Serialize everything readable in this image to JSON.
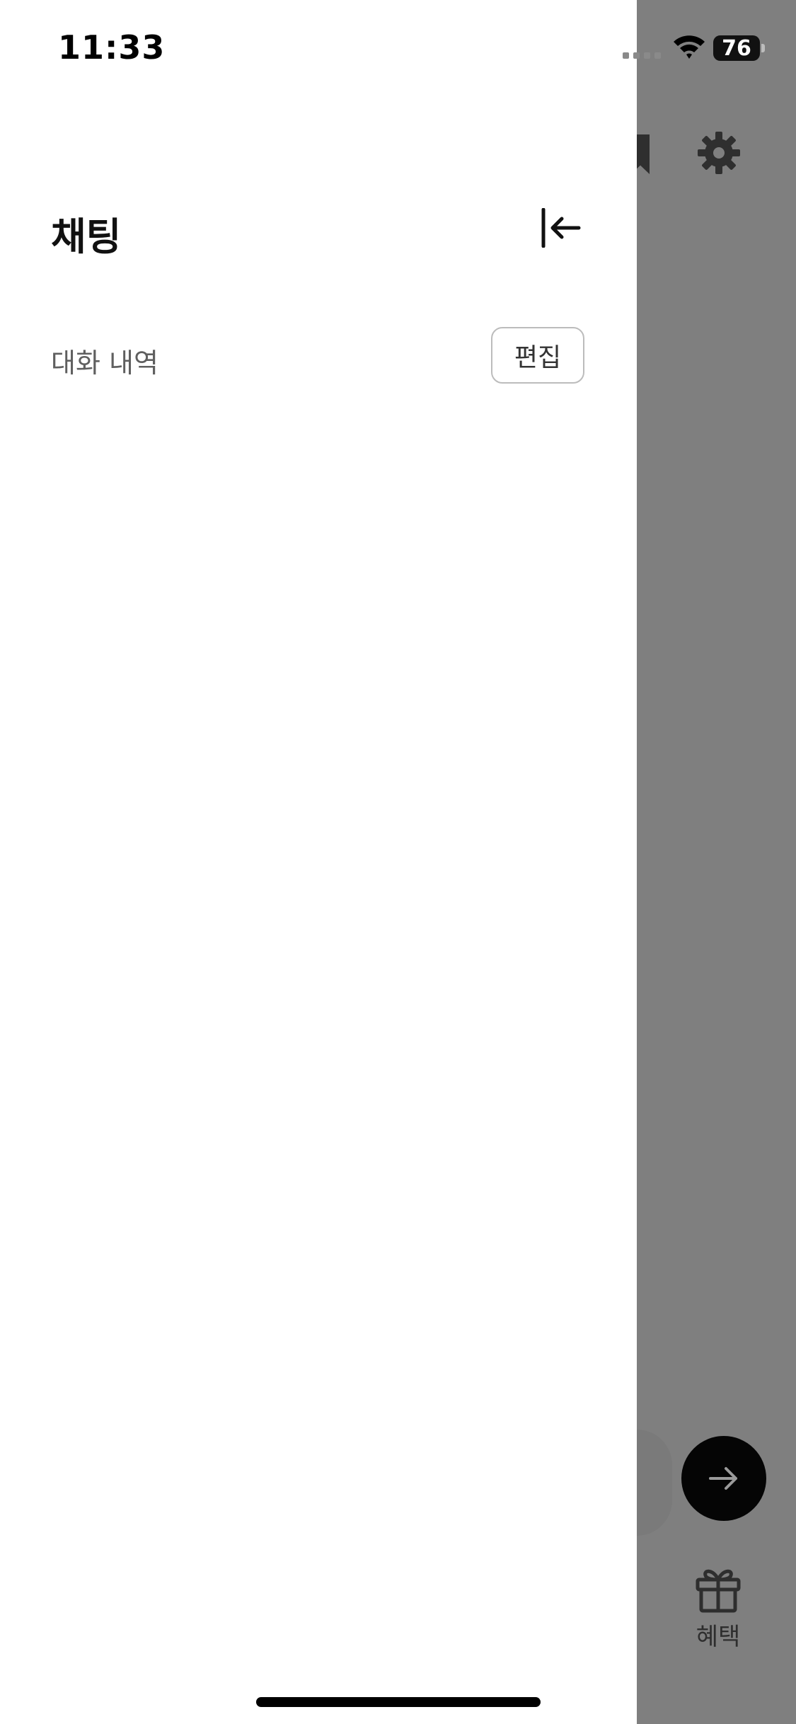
{
  "status_bar": {
    "time": "11:33",
    "battery": "76"
  },
  "drawer": {
    "title": "채팅",
    "section_label": "대화 내역",
    "edit_label": "편집"
  },
  "background_app": {
    "gift_label": "혜택"
  },
  "colors": {
    "overlay": "#7f7f7f",
    "drawer_bg": "#ffffff",
    "send_button": "#050505"
  },
  "icons": {
    "collapse": "collapse-left-icon",
    "settings": "gear-icon",
    "bookmark": "bookmark-icon",
    "send": "arrow-right-icon",
    "gift": "gift-icon",
    "wifi": "wifi-icon"
  }
}
